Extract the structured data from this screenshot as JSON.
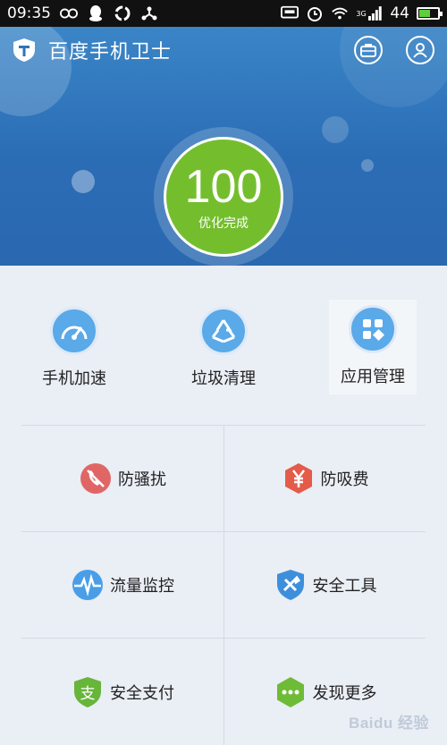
{
  "status_bar": {
    "time": "09:35",
    "network_label": "3G",
    "battery_level": "44",
    "left_icons": [
      "infinity-icon",
      "qq-icon",
      "refresh-icon",
      "share-icon"
    ],
    "right_icons": [
      "message-icon",
      "alarm-icon",
      "wifi-icon",
      "signal-icon",
      "battery-icon"
    ]
  },
  "header": {
    "app_title": "百度手机卫士",
    "actions": [
      "toolbox-icon",
      "user-icon"
    ],
    "score": {
      "value": "100",
      "label": "优化完成",
      "color": "#74be2e"
    },
    "background_color": "#2b6db5"
  },
  "quick_actions": [
    {
      "label": "手机加速",
      "icon": "speedometer-icon"
    },
    {
      "label": "垃圾清理",
      "icon": "recycle-icon"
    },
    {
      "label": "应用管理",
      "icon": "apps-grid-icon",
      "selected": true
    }
  ],
  "tools": [
    {
      "label": "防骚扰",
      "icon": "blocked-phone-icon",
      "color": "#e06666"
    },
    {
      "label": "防吸费",
      "icon": "yuan-shield-icon",
      "color": "#e45b4a"
    },
    {
      "label": "流量监控",
      "icon": "pulse-icon",
      "color": "#4a9ee8"
    },
    {
      "label": "安全工具",
      "icon": "wrench-shield-icon",
      "color": "#3d8fdc"
    },
    {
      "label": "安全支付",
      "icon": "pay-shield-icon",
      "color": "#67b53a"
    },
    {
      "label": "发现更多",
      "icon": "more-dots-icon",
      "color": "#6ebb37"
    }
  ],
  "watermark": "Baidu 经验"
}
